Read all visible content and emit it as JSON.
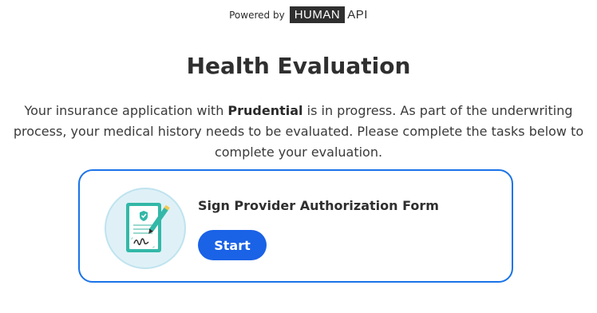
{
  "header": {
    "powered_by": "Powered by",
    "logo_left": "HUMAN",
    "logo_right": "API"
  },
  "page": {
    "title": "Health Evaluation",
    "intro_before": "Your insurance application with ",
    "intro_company": "Prudential",
    "intro_after": " is in progress. As part of the underwriting process, your medical history needs to be evaluated. Please complete the tasks below to complete your evaluation."
  },
  "task": {
    "title": "Sign Provider Authorization Form",
    "button_label": "Start",
    "icon": "signed-document-icon"
  },
  "colors": {
    "accent": "#1a62e6",
    "card_border": "#1a73e8",
    "illustration_bg": "#dff1f7",
    "document_teal": "#33b8a8"
  }
}
